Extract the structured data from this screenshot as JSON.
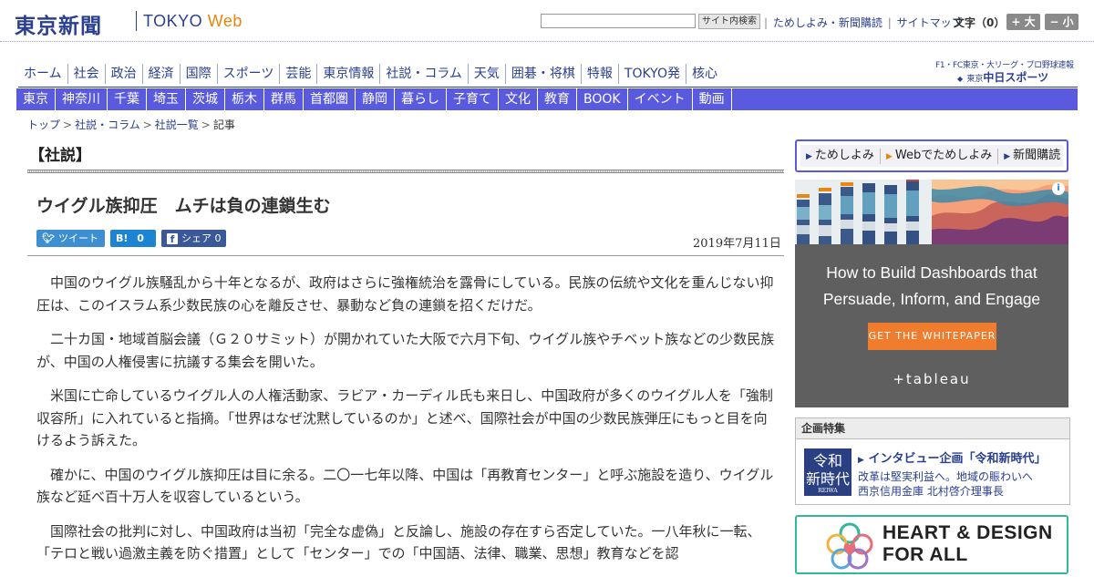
{
  "header": {
    "logo": "東京新聞",
    "tokyo_text": "TOKYO",
    "web_text": "Web",
    "search_button": "サイト内検索",
    "links": [
      "ためしよみ・新聞購読",
      "サイトマップ"
    ],
    "font_size_label": "文字（0）",
    "font_big": "+ 大",
    "font_small": "− 小"
  },
  "nav_primary": [
    "ホーム",
    "社会",
    "政治",
    "経済",
    "国際",
    "スポーツ",
    "芸能",
    "東京情報",
    "社説・コラム",
    "天気",
    "囲碁・将棋",
    "特報",
    "TOKYO発",
    "核心"
  ],
  "chunichi": {
    "line1": "F1・FC東京・大リーグ・プロ野球速報",
    "prefix": "東京",
    "name": "中日スポーツ"
  },
  "nav_secondary": [
    "東京",
    "神奈川",
    "千葉",
    "埼玉",
    "茨城",
    "栃木",
    "群馬",
    "首都圏",
    "静岡",
    "暮らし",
    "子育て",
    "文化",
    "教育",
    "BOOK",
    "イベント",
    "動画"
  ],
  "breadcrumb": [
    "トップ",
    "社説・コラム",
    "社説一覧"
  ],
  "breadcrumb_current": "記事",
  "article": {
    "section": "【社説】",
    "headline": "ウイグル族抑圧　ムチは負の連鎖生む",
    "share": {
      "tweet": "ツイート",
      "hatena_label": "B!",
      "hatena_count": "0",
      "facebook": "シェア",
      "facebook_count": "0"
    },
    "date": "2019年7月11日",
    "paragraphs": [
      "中国のウイグル族騒乱から十年となるが、政府はさらに強権統治を露骨にしている。民族の伝統や文化を重んじない抑圧は、このイスラム系少数民族の心を離反させ、暴動など負の連鎖を招くだけだ。",
      "二十カ国・地域首脳会議（Ｇ２０サミット）が開かれていた大阪で六月下旬、ウイグル族やチベット族などの少数民族が、中国の人権侵害に抗議する集会を開いた。",
      "米国に亡命しているウイグル人の人権活動家、ラビア・カーディル氏も来日し、中国政府が多くのウイグル人を「強制収容所」に入れていると指摘。「世界はなぜ沈黙しているのか」と述べ、国際社会が中国の少数民族弾圧にもっと目を向けるよう訴えた。",
      "確かに、中国のウイグル族抑圧は目に余る。二〇一七年以降、中国は「再教育センター」と呼ぶ施設を造り、ウイグル族など延べ百十万人を収容しているという。",
      "国際社会の批判に対し、中国政府は当初「完全な虚偽」と反論し、施設の存在すら否定していた。一八年秋に一転、「テロと戦い過激主義を防ぐ措置」として「センター」での「中国語、法律、職業、思想」教育などを認"
    ]
  },
  "sidebar": {
    "promo": [
      "ためしよみ",
      "Webでためしよみ",
      "新聞購読"
    ],
    "ad": {
      "headline_1": "How to Build Dashboards that",
      "headline_2": "Persuade, Inform, and Engage",
      "cta": "GET THE WHITEPAPER",
      "brand": "+tableau",
      "adchoice": "i"
    },
    "feature": {
      "header": "企画特集",
      "logo_top": "令和",
      "logo_bottom": "新時代",
      "logo_small": "REIWA",
      "title": "インタビュー企画「令和新時代」",
      "sub_1": "改革は堅実利益へ。地域の賑わいへ",
      "sub_2": "西京信用金庫 北村啓介理事長"
    },
    "heart_banner": {
      "line1": "HEART & DESIGN",
      "line2": "FOR ALL"
    }
  },
  "colors": {
    "brand_blue": "#2a3f8f",
    "nav_purple": "#5a5adf",
    "web_orange": "#e8860f",
    "cta_orange": "#f07c2d",
    "ad_gray": "#5f5f5f"
  }
}
